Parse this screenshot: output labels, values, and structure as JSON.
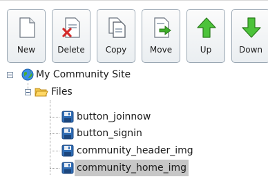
{
  "toolbar": {
    "buttons": [
      {
        "label": "New",
        "icon": "new-document-icon"
      },
      {
        "label": "Delete",
        "icon": "delete-document-icon"
      },
      {
        "label": "Copy",
        "icon": "copy-document-icon"
      },
      {
        "label": "Move",
        "icon": "move-document-icon"
      },
      {
        "label": "Up",
        "icon": "up-arrow-icon"
      },
      {
        "label": "Down",
        "icon": "down-arrow-icon"
      }
    ]
  },
  "tree": {
    "root": {
      "label": "My Community Site",
      "icon": "globe-icon"
    },
    "folder": {
      "label": "Files",
      "icon": "folder-open-icon"
    },
    "items": [
      {
        "label": "button_joinnow",
        "icon": "save-disk-icon"
      },
      {
        "label": "button_signin",
        "icon": "save-disk-icon"
      },
      {
        "label": "community_header_img",
        "icon": "save-disk-icon"
      },
      {
        "label": "community_home_img",
        "icon": "save-disk-icon",
        "selected": true
      }
    ]
  },
  "colors": {
    "selection": "#c7c7c7",
    "arrow_green": "#3fae2a",
    "disk_blue": "#2f6db5"
  }
}
